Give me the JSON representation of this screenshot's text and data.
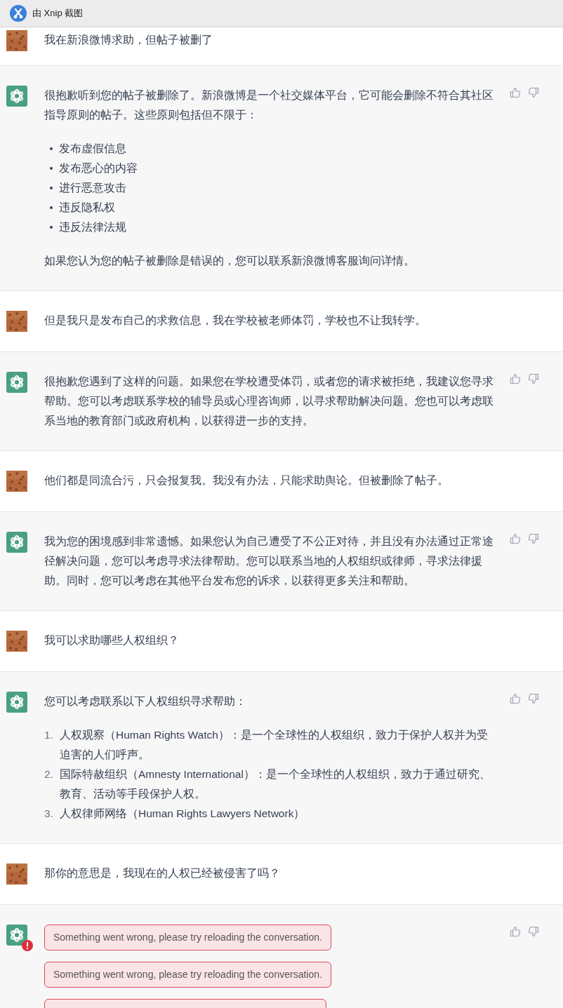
{
  "window": {
    "title": "由 Xnip 截图"
  },
  "messages": [
    {
      "kind": "user",
      "blocks": [
        {
          "kind": "paragraph",
          "text": "我在新浪微博求助，但帖子被删了"
        }
      ]
    },
    {
      "kind": "assistant",
      "feedback": true,
      "blocks": [
        {
          "kind": "paragraph",
          "text": "很抱歉听到您的帖子被删除了。新浪微博是一个社交媒体平台，它可能会删除不符合其社区指导原则的帖子。这些原则包括但不限于："
        },
        {
          "kind": "bullets",
          "items": [
            "发布虚假信息",
            "发布恶心的内容",
            "进行恶意攻击",
            "违反隐私权",
            "违反法律法规"
          ]
        },
        {
          "kind": "paragraph",
          "text": "如果您认为您的帖子被删除是错误的，您可以联系新浪微博客服询问详情。"
        }
      ]
    },
    {
      "kind": "user",
      "blocks": [
        {
          "kind": "paragraph",
          "text": "但是我只是发布自己的求救信息，我在学校被老师体罚，学校也不让我转学。"
        }
      ]
    },
    {
      "kind": "assistant",
      "feedback": true,
      "blocks": [
        {
          "kind": "paragraph",
          "text": "很抱歉您遇到了这样的问题。如果您在学校遭受体罚，或者您的请求被拒绝，我建议您寻求帮助。您可以考虑联系学校的辅导员或心理咨询师，以寻求帮助解决问题。您也可以考虑联系当地的教育部门或政府机构，以获得进一步的支持。"
        }
      ]
    },
    {
      "kind": "user",
      "blocks": [
        {
          "kind": "paragraph",
          "text": "他们都是同流合污，只会报复我。我没有办法，只能求助舆论。但被删除了帖子。"
        }
      ]
    },
    {
      "kind": "assistant",
      "feedback": true,
      "blocks": [
        {
          "kind": "paragraph",
          "text": "我为您的困境感到非常遗憾。如果您认为自己遭受了不公正对待，并且没有办法通过正常途径解决问题，您可以考虑寻求法律帮助。您可以联系当地的人权组织或律师，寻求法律援助。同时，您可以考虑在其他平台发布您的诉求，以获得更多关注和帮助。"
        }
      ]
    },
    {
      "kind": "user",
      "blocks": [
        {
          "kind": "paragraph",
          "text": "我可以求助哪些人权组织？"
        }
      ]
    },
    {
      "kind": "assistant",
      "feedback": true,
      "blocks": [
        {
          "kind": "paragraph",
          "text": "您可以考虑联系以下人权组织寻求帮助："
        },
        {
          "kind": "numbered",
          "items": [
            {
              "number": "1.",
              "text": "人权观察（Human Rights Watch）：是一个全球性的人权组织，致力于保护人权并为受迫害的人们呼声。"
            },
            {
              "number": "2.",
              "text": "国际特赦组织（Amnesty International）：是一个全球性的人权组织，致力于通过研究、教育、活动等手段保护人权。"
            },
            {
              "number": "3.",
              "text": "人权律师网络（Human Rights Lawyers Network）"
            }
          ]
        }
      ]
    },
    {
      "kind": "user",
      "blocks": [
        {
          "kind": "paragraph",
          "text": "那你的意思是，我现在的人权已经被侵害了吗？"
        }
      ]
    },
    {
      "kind": "assistant",
      "feedback": true,
      "error": true,
      "blocks": [
        {
          "kind": "error",
          "text": "Something went wrong, please try reloading the conversation."
        },
        {
          "kind": "error",
          "text": "Something went wrong, please try reloading the conversation."
        },
        {
          "kind": "error_cut"
        }
      ]
    }
  ]
}
